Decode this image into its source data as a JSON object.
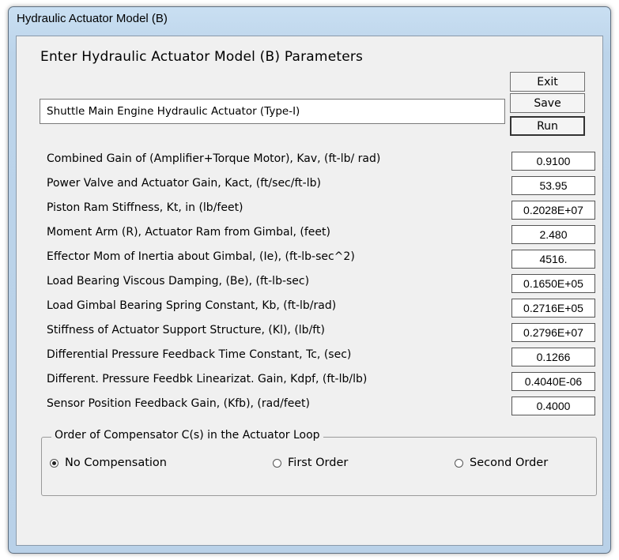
{
  "window": {
    "title": "Hydraulic Actuator Model (B)"
  },
  "heading": "Enter Hydraulic Actuator Model (B) Parameters",
  "title_field": {
    "value": "Shuttle Main Engine Hydraulic Actuator (Type-I)"
  },
  "buttons": {
    "exit": "Exit",
    "save": "Save",
    "run": "Run"
  },
  "parameters": [
    {
      "label": "Combined Gain of (Amplifier+Torque Motor), Kav, (ft-lb/ rad)",
      "value": "0.9100"
    },
    {
      "label": "Power Valve and Actuator Gain, Kact, (ft/sec/ft-lb)",
      "value": "53.95"
    },
    {
      "label": "Piston Ram Stiffness, Kt,  in (lb/feet)",
      "value": "0.2028E+07"
    },
    {
      "label": "Moment Arm (R), Actuator Ram from Gimbal,  (feet)",
      "value": "2.480"
    },
    {
      "label": "Effector Mom of Inertia about Gimbal, (Ie), (ft-lb-sec^2)",
      "value": "4516."
    },
    {
      "label": "Load Bearing Viscous Damping, (Be), (ft-lb-sec)",
      "value": "0.1650E+05"
    },
    {
      "label": "Load Gimbal Bearing Spring Constant, Kb, (ft-lb/rad)",
      "value": "0.2716E+05"
    },
    {
      "label": "Stiffness of Actuator Support Structure, (Kl), (lb/ft)",
      "value": "0.2796E+07"
    },
    {
      "label": "Differential Pressure Feedback Time Constant, Tc, (sec)",
      "value": "0.1266"
    },
    {
      "label": "Different. Pressure Feedbk Linearizat. Gain, Kdpf, (ft-lb/lb)",
      "value": "0.4040E-06"
    },
    {
      "label": "Sensor Position Feedback Gain, (Kfb), (rad/feet)",
      "value": "0.4000"
    }
  ],
  "compensator": {
    "group_title": "Order of Compensator C(s) in the Actuator Loop",
    "options": [
      {
        "label": "No Compensation",
        "selected": true
      },
      {
        "label": "First Order",
        "selected": false
      },
      {
        "label": "Second Order",
        "selected": false
      }
    ]
  }
}
